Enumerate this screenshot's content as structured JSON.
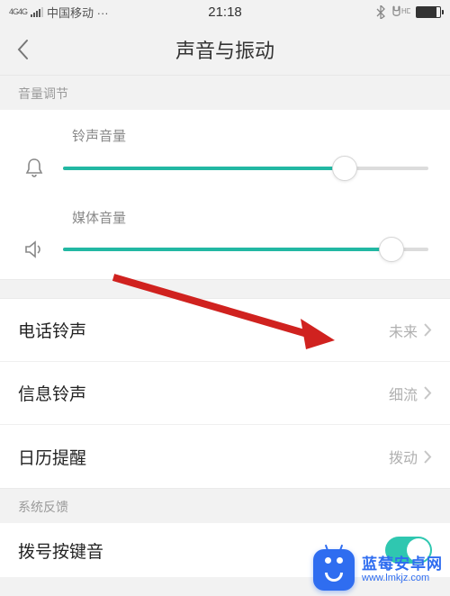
{
  "statusbar": {
    "carrier": "中国移动 ···",
    "signal_badge": "4G4G",
    "time": "21:18",
    "hd_badge": "HD"
  },
  "nav": {
    "title": "声音与振动"
  },
  "sections": {
    "volume_header": "音量调节",
    "feedback_header": "系统反馈"
  },
  "sliders": {
    "ring": {
      "label": "铃声音量",
      "percent": 77
    },
    "media": {
      "label": "媒体音量",
      "percent": 90
    }
  },
  "rows": {
    "phone_ringtone": {
      "title": "电话铃声",
      "value": "未来"
    },
    "message_ringtone": {
      "title": "信息铃声",
      "value": "细流"
    },
    "calendar_reminder": {
      "title": "日历提醒",
      "value": "拨动"
    },
    "dial_keypad": {
      "title": "拨号按键音",
      "enabled": true
    }
  },
  "watermark": {
    "title": "蓝莓安卓网",
    "url": "www.lmkjz.com"
  }
}
